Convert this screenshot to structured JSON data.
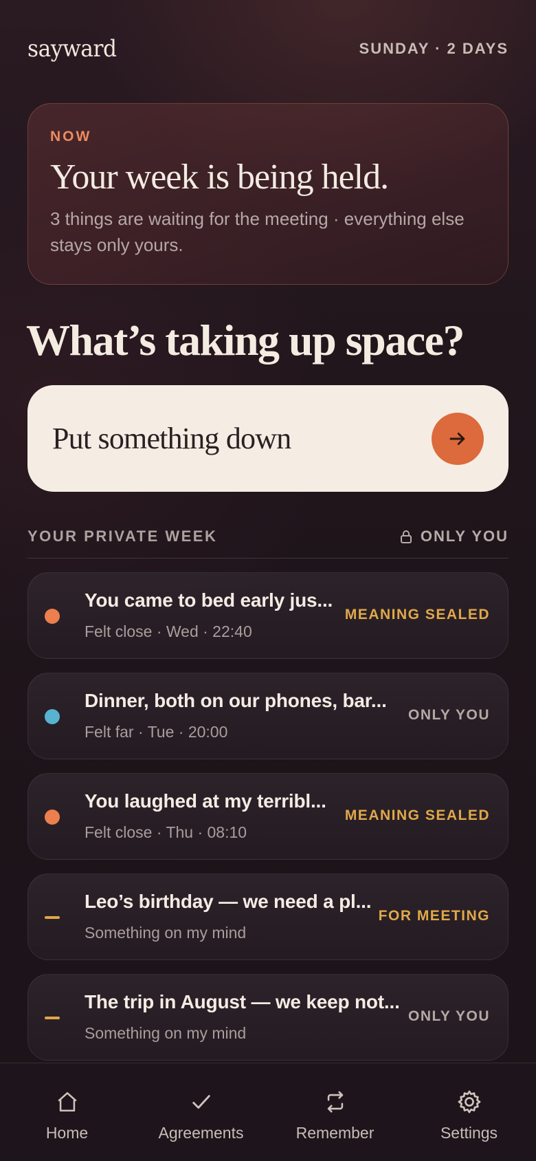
{
  "app": {
    "logo": "sayward",
    "week_status": "SUNDAY · 2 DAYS"
  },
  "now_card": {
    "eyebrow": "NOW",
    "title": "Your week is being held.",
    "body": "3 things are waiting for the meeting · everything else stays only yours."
  },
  "prompt": {
    "title": "What’s taking up space?",
    "placeholder": "Put something down",
    "send_icon": "arrow-right-icon"
  },
  "section": {
    "label": "YOUR PRIVATE WEEK",
    "privacy_label": "ONLY YOU",
    "privacy_icon": "lock-icon"
  },
  "items": [
    {
      "title": "You came to bed early jus...",
      "meta": "Felt close · Wed · 22:40",
      "tag": "MEANING SEALED",
      "marker": "dot",
      "marker_color": "#ec7f4e",
      "tag_color": "#e1a84a"
    },
    {
      "title": "Dinner, both on our phones, bar...",
      "meta": "Felt far · Tue · 20:00",
      "tag": "ONLY YOU",
      "marker": "dot",
      "marker_color": "#57b3cf",
      "tag_color": "#b4a9a6"
    },
    {
      "title": "You laughed at my terribl...",
      "meta": "Felt close · Thu · 08:10",
      "tag": "MEANING SEALED",
      "marker": "dot",
      "marker_color": "#ec7f4e",
      "tag_color": "#e1a84a"
    },
    {
      "title": "Leo’s birthday — we need a pl...",
      "meta": "Something on my mind",
      "tag": "FOR MEETING",
      "marker": "dash",
      "marker_color": "#e2a548",
      "tag_color": "#e1a84a"
    },
    {
      "title": "The trip in August — we keep not...",
      "meta": "Something on my mind",
      "tag": "ONLY YOU",
      "marker": "dash",
      "marker_color": "#e2a548",
      "tag_color": "#b4a9a6"
    }
  ],
  "nav": [
    {
      "label": "Home",
      "icon": "home-icon"
    },
    {
      "label": "Agreements",
      "icon": "checkmark-icon"
    },
    {
      "label": "Remember",
      "icon": "repeat-icon"
    },
    {
      "label": "Settings",
      "icon": "gear-icon"
    }
  ]
}
